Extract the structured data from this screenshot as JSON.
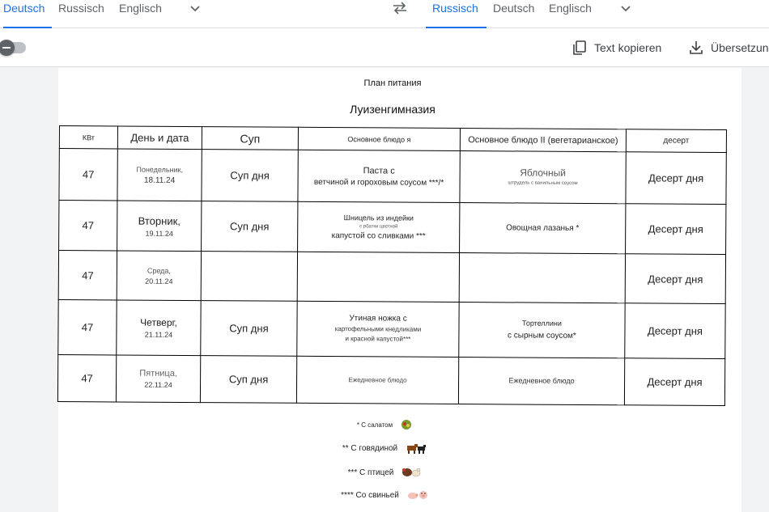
{
  "source_tabs": [
    "Deutsch",
    "Russisch",
    "Englisch"
  ],
  "target_tabs": [
    "Russisch",
    "Deutsch",
    "Englisch"
  ],
  "toolbar": {
    "copy_label": "Text kopieren",
    "download_label": "Übersetzung"
  },
  "document": {
    "title": "План питания",
    "subtitle": "Луизенгимназия",
    "headers": {
      "kw": "КВт",
      "day": "День и дата",
      "soup": "Суп",
      "main1": "Основное блюдо я",
      "main2": "Основное блюдо II (вегетарианское)",
      "dessert": "десерт"
    },
    "rows": [
      {
        "kw": "47",
        "day": "Понедельник,",
        "date": "18.11.24",
        "soup": "Суп дня",
        "main1_line1": "Паста с",
        "main1_line2": "ветчиной и гороховым соусом ***/*",
        "main1_line3": "",
        "main2_line1": "Яблочный",
        "main2_line2": "штрудель с ванильным соусом",
        "dessert": "Десерт дня"
      },
      {
        "kw": "47",
        "day": "Вторник,",
        "date": "19.11.24",
        "soup": "Суп дня",
        "main1_line1": "Шницель из индейки",
        "main1_line2": "с рбатки цветной",
        "main1_line3": "капустой со сливками ***",
        "main2_line1": "Овощная лазанья *",
        "main2_line2": "",
        "dessert": "Десерт дня"
      },
      {
        "kw": "47",
        "day": "Среда,",
        "date": "20.11.24",
        "soup": "",
        "main1_line1": "",
        "main1_line2": "",
        "main1_line3": "",
        "main2_line1": "",
        "main2_line2": "",
        "dessert": "Десерт дня"
      },
      {
        "kw": "47",
        "day": "Четверг,",
        "date": "21.11.24",
        "soup": "Суп дня",
        "main1_line1": "Утиная ножка с",
        "main1_line2": "картофельными кнедликами",
        "main1_line3": "и красной капустой***",
        "main2_line1": "Тортеллини",
        "main2_line2": "с сырным соусом*",
        "dessert": "Десерт дня"
      },
      {
        "kw": "47",
        "day": "Пятница,",
        "date": "22.11.24",
        "soup": "Суп дня",
        "main1_line1": "Ежедневное блюдо",
        "main1_line2": "",
        "main1_line3": "",
        "main2_line1": "Ежедневное блюдо",
        "main2_line2": "",
        "dessert": "Десерт дня"
      }
    ],
    "legend": [
      {
        "text": "* С салатом",
        "icon": "salad-icon"
      },
      {
        "text": "** С говядиной",
        "icon": "cow-icon"
      },
      {
        "text": "*** С птицей",
        "icon": "poultry-icon"
      },
      {
        "text": "**** Со свиньей",
        "icon": "pig-icon"
      }
    ]
  },
  "colors": {
    "accent": "#1a73e8",
    "soup_header": "#d0301f",
    "main1_header": "#1a3f9c",
    "main2_header": "#1e7b1e",
    "dessert_header": "#8e2b8e"
  }
}
